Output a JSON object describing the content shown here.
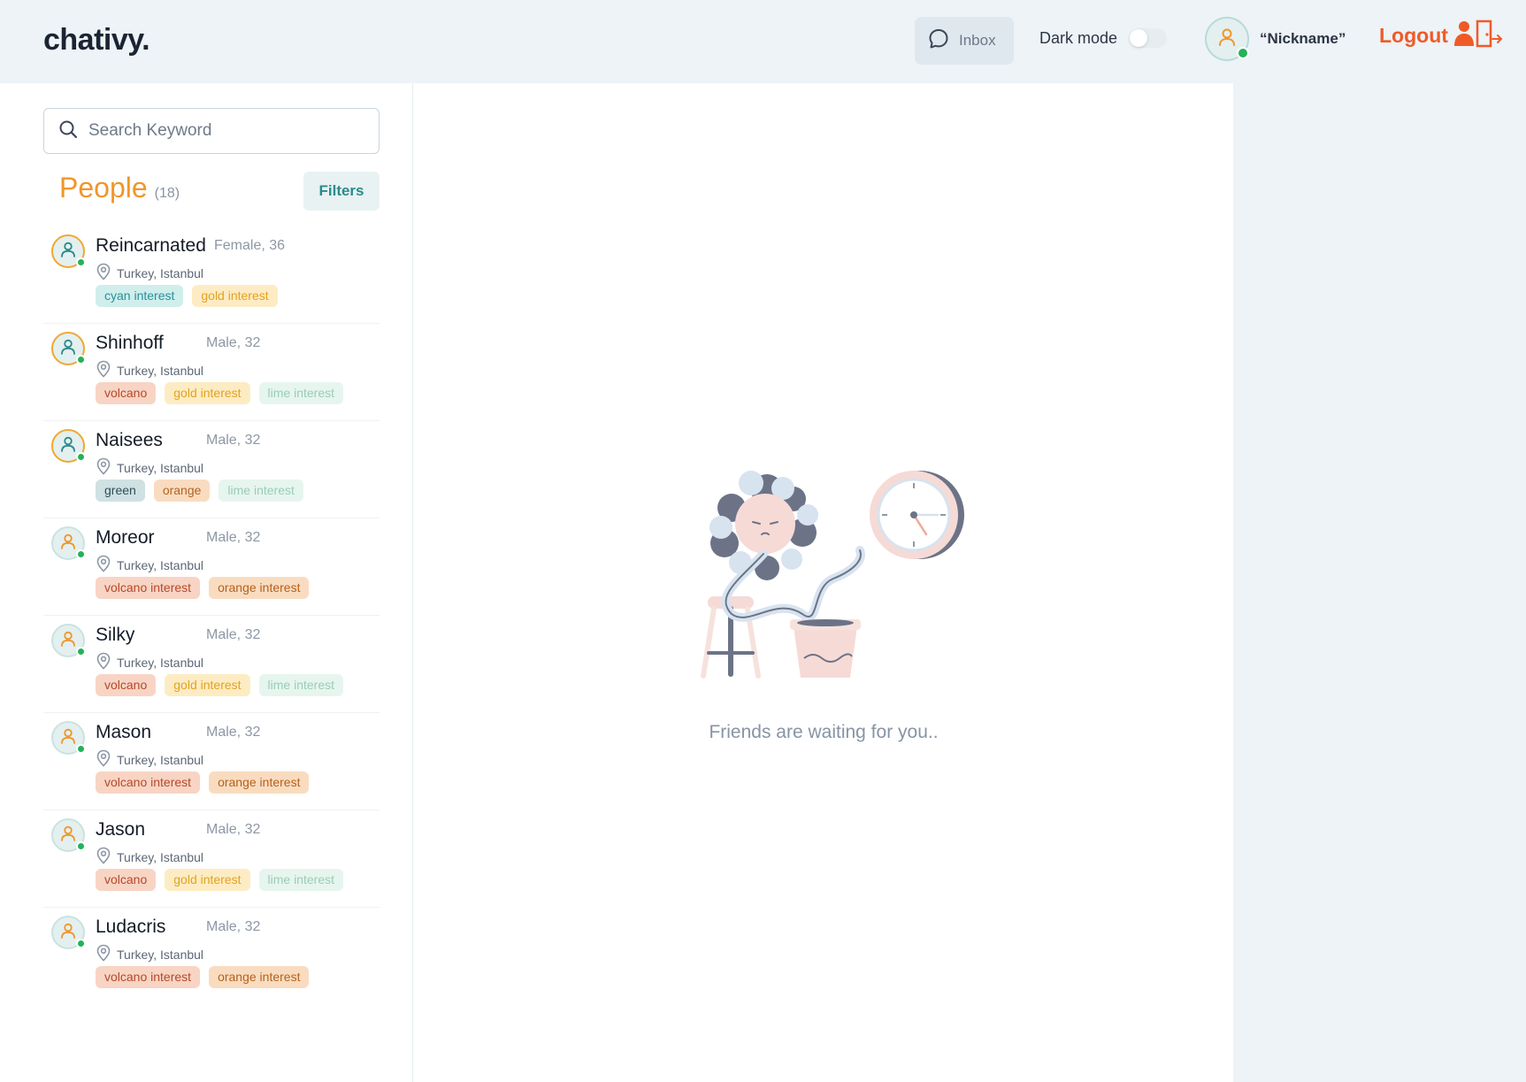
{
  "header": {
    "logo": "chativy.",
    "inbox_label": "Inbox",
    "dark_mode_label": "Dark mode",
    "dark_mode_on": false,
    "nickname": "“Nickname”",
    "logout_label": "Logout"
  },
  "sidebar": {
    "search_placeholder": "Search Keyword",
    "people_title": "People",
    "people_count": "(18)",
    "filters_label": "Filters",
    "people": [
      {
        "name": "Reincarnated",
        "meta": "Female, 36",
        "location": "Turkey, Istanbul",
        "ring": true,
        "tags": [
          {
            "label": "cyan interest",
            "color": "cyan"
          },
          {
            "label": "gold interest",
            "color": "gold"
          }
        ]
      },
      {
        "name": "Shinhoff",
        "meta": "Male, 32",
        "location": "Turkey, Istanbul",
        "ring": true,
        "tags": [
          {
            "label": "volcano",
            "color": "volcano"
          },
          {
            "label": "gold interest",
            "color": "gold"
          },
          {
            "label": "lime interest",
            "color": "lime"
          }
        ]
      },
      {
        "name": "Naisees",
        "meta": "Male, 32",
        "location": "Turkey, Istanbul",
        "ring": true,
        "tags": [
          {
            "label": "green",
            "color": "green"
          },
          {
            "label": "orange",
            "color": "orange"
          },
          {
            "label": "lime interest",
            "color": "lime"
          }
        ]
      },
      {
        "name": "Moreor",
        "meta": "Male, 32",
        "location": "Turkey, Istanbul",
        "ring": false,
        "tags": [
          {
            "label": "volcano interest",
            "color": "volcano"
          },
          {
            "label": "orange interest",
            "color": "orange"
          }
        ]
      },
      {
        "name": "Silky",
        "meta": "Male, 32",
        "location": "Turkey, Istanbul",
        "ring": false,
        "tags": [
          {
            "label": "volcano",
            "color": "volcano"
          },
          {
            "label": "gold interest",
            "color": "gold"
          },
          {
            "label": "lime interest",
            "color": "lime"
          }
        ]
      },
      {
        "name": "Mason",
        "meta": "Male, 32",
        "location": "Turkey, Istanbul",
        "ring": false,
        "tags": [
          {
            "label": "volcano interest",
            "color": "volcano"
          },
          {
            "label": "orange interest",
            "color": "orange"
          }
        ]
      },
      {
        "name": "Jason",
        "meta": "Male, 32",
        "location": "Turkey, Istanbul",
        "ring": false,
        "tags": [
          {
            "label": "volcano",
            "color": "volcano"
          },
          {
            "label": "gold interest",
            "color": "gold"
          },
          {
            "label": "lime interest",
            "color": "lime"
          }
        ]
      },
      {
        "name": "Ludacris",
        "meta": "Male, 32",
        "location": "Turkey, Istanbul",
        "ring": false,
        "tags": [
          {
            "label": "volcano interest",
            "color": "volcano"
          },
          {
            "label": "orange interest",
            "color": "orange"
          }
        ]
      }
    ]
  },
  "main": {
    "empty_text": "Friends are waiting for you.."
  },
  "colors": {
    "accent": "#f0962a",
    "logout": "#f05a28",
    "online": "#22b25a",
    "background": "#edf3f6"
  },
  "icons": {
    "inbox": "chat-bubble-icon",
    "search": "search-icon",
    "user": "user-icon",
    "location": "location-pin-icon",
    "logout": "door-exit-icon"
  }
}
